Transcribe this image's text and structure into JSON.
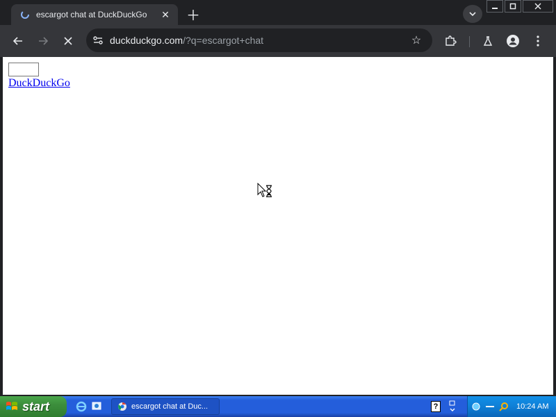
{
  "browser": {
    "tab_title": "escargot chat at DuckDuckGo",
    "url_domain": "duckduckgo.com",
    "url_path": "/?q=escargot+chat"
  },
  "page": {
    "search_value": "",
    "link_text": "DuckDuckGo"
  },
  "taskbar": {
    "start_label": "start",
    "task_label": "escargot chat at Duc...",
    "clock": "10:24 AM",
    "help_glyph": "?"
  },
  "colors": {
    "chrome_dark": "#202124",
    "chrome_toolbar": "#35363a",
    "link": "#0000ee",
    "xp_taskbar": "#245edb",
    "xp_start": "#3c8e3c"
  }
}
